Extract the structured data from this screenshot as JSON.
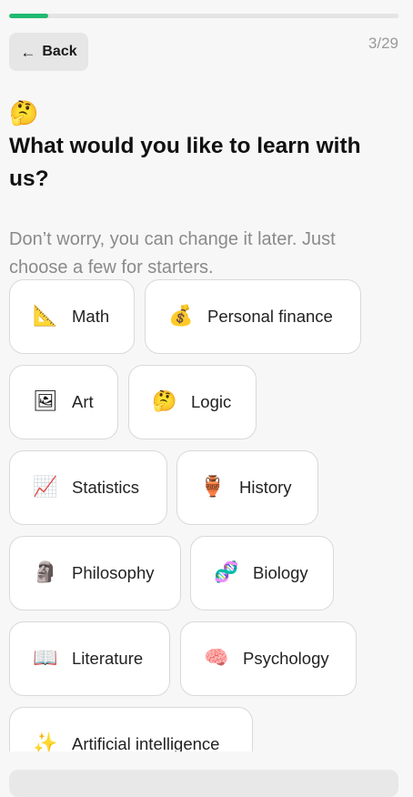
{
  "header": {
    "back_label": "Back",
    "step_counter": "3/29",
    "progress_fraction": 0.1
  },
  "question": {
    "emoji": "🤔",
    "title": "What would you like to learn with us?",
    "subtitle": "Don’t worry, you can change it later. Just choose a few for starters."
  },
  "options": [
    {
      "icon": "📐",
      "icon_name": "triangular-ruler-icon",
      "label": "Math"
    },
    {
      "icon": "💰",
      "icon_name": "money-bag-icon",
      "label": "Personal finance"
    },
    {
      "icon": "🖼",
      "icon_name": "framed-picture-icon",
      "label": "Art"
    },
    {
      "icon": "🤔",
      "icon_name": "thinking-face-icon",
      "label": "Logic"
    },
    {
      "icon": "📈",
      "icon_name": "chart-increasing-icon",
      "label": "Statistics"
    },
    {
      "icon": "🏺",
      "icon_name": "amphora-icon",
      "label": "History"
    },
    {
      "icon": "🗿",
      "icon_name": "moai-icon",
      "label": "Philosophy"
    },
    {
      "icon": "🧬",
      "icon_name": "dna-icon",
      "label": "Biology"
    },
    {
      "icon": "📖",
      "icon_name": "open-book-icon",
      "label": "Literature"
    },
    {
      "icon": "🧠",
      "icon_name": "brain-icon",
      "label": "Psychology"
    },
    {
      "icon": "✨",
      "icon_name": "sparkles-icon",
      "label": "Artificial intelligence"
    }
  ],
  "colors": {
    "accent": "#1fba72",
    "background": "#f7f7f7",
    "chip_border": "#d9d9d9"
  }
}
